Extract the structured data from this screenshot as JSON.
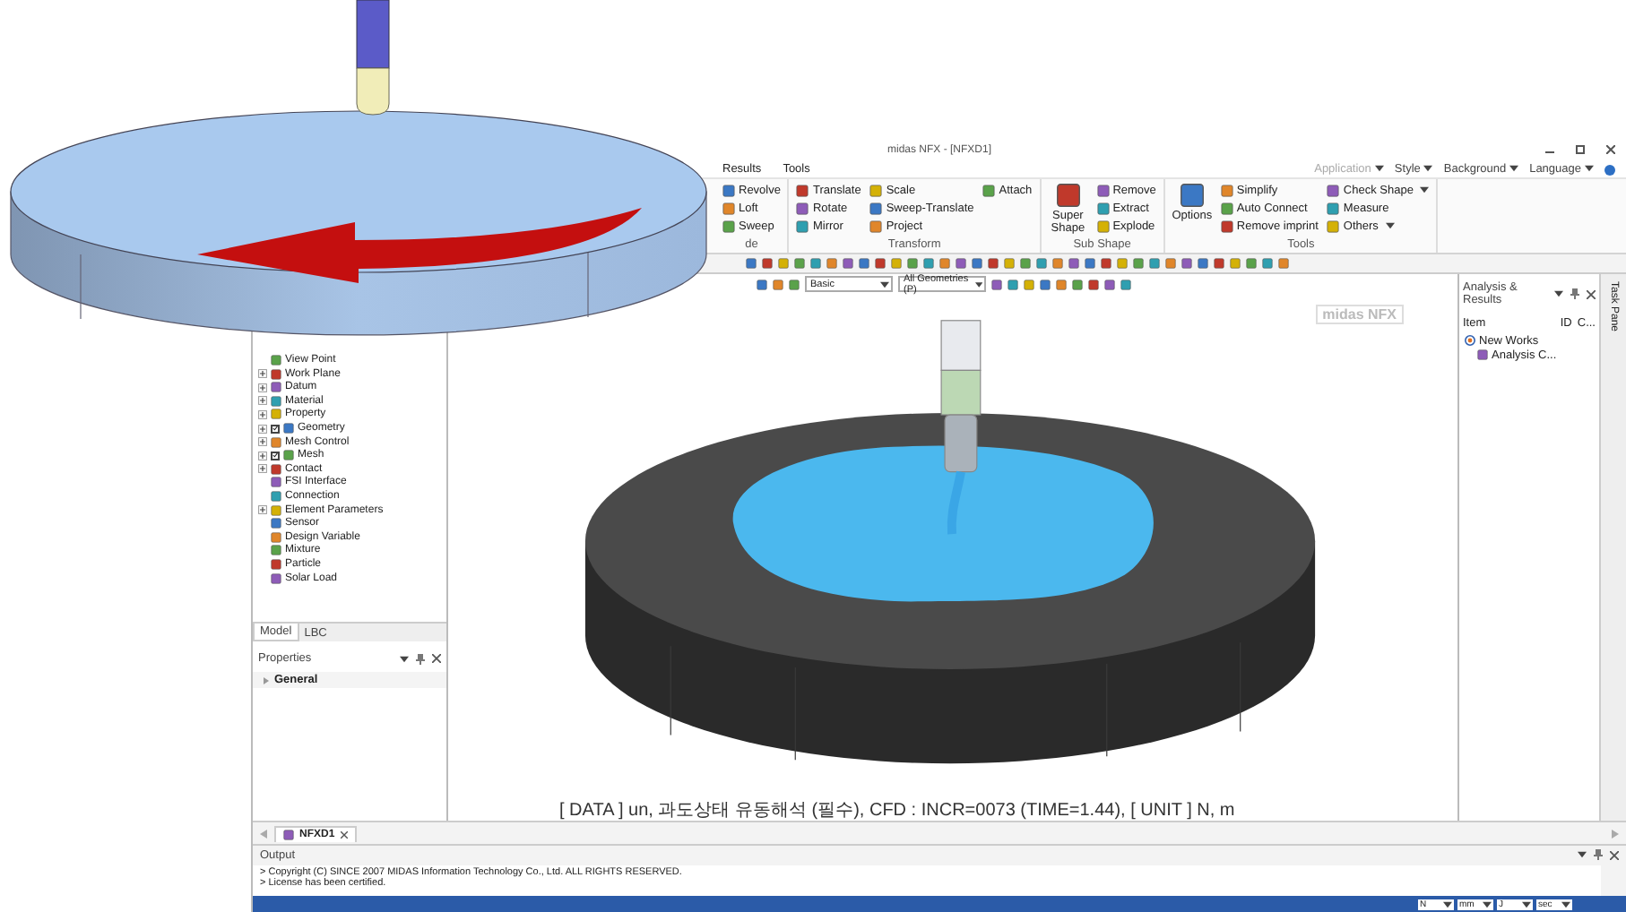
{
  "window": {
    "title": "midas NFX - [NFXD1]"
  },
  "menu": [
    {
      "label": "Results"
    },
    {
      "label": "Tools"
    }
  ],
  "quick_menu": [
    {
      "label": "Application",
      "disabled": true
    },
    {
      "label": "Style",
      "disabled": false
    },
    {
      "label": "Background",
      "disabled": false
    },
    {
      "label": "Language",
      "disabled": false
    }
  ],
  "ribbon": [
    {
      "label": "de",
      "columns": [
        [
          {
            "label": "Revolve",
            "kind": "small"
          },
          {
            "label": "Loft",
            "kind": "small"
          },
          {
            "label": "Sweep",
            "kind": "small"
          }
        ]
      ]
    },
    {
      "label": "Transform",
      "columns": [
        [
          {
            "label": "Translate",
            "kind": "small"
          },
          {
            "label": "Rotate",
            "kind": "small"
          },
          {
            "label": "Mirror",
            "kind": "small"
          }
        ],
        [
          {
            "label": "Scale",
            "kind": "small"
          },
          {
            "label": "Sweep-Translate",
            "kind": "small"
          },
          {
            "label": "Project",
            "kind": "small"
          }
        ],
        [
          {
            "label": "Attach",
            "kind": "small"
          }
        ]
      ]
    },
    {
      "label": "Sub Shape",
      "columns": [
        [
          {
            "label": "Super Shape",
            "kind": "large"
          }
        ],
        [
          {
            "label": "Remove",
            "kind": "small"
          },
          {
            "label": "Extract",
            "kind": "small"
          },
          {
            "label": "Explode",
            "kind": "small"
          }
        ]
      ]
    },
    {
      "label": "Tools",
      "columns": [
        [
          {
            "label": "Options",
            "kind": "large"
          }
        ],
        [
          {
            "label": "Simplify",
            "kind": "small"
          },
          {
            "label": "Auto Connect",
            "kind": "small"
          },
          {
            "label": "Remove imprint",
            "kind": "small"
          }
        ],
        [
          {
            "label": "Check Shape",
            "kind": "menu"
          },
          {
            "label": "Measure",
            "kind": "small"
          },
          {
            "label": "Others",
            "kind": "menu"
          }
        ]
      ]
    }
  ],
  "tree": [
    {
      "label": "View Point",
      "expandable": false,
      "kind": "plain"
    },
    {
      "label": "Work Plane",
      "expandable": true,
      "kind": "plain"
    },
    {
      "label": "Datum",
      "expandable": true,
      "kind": "plain"
    },
    {
      "label": "Material",
      "expandable": true,
      "kind": "plain"
    },
    {
      "label": "Property",
      "expandable": true,
      "kind": "plain"
    },
    {
      "label": "Geometry",
      "expandable": true,
      "kind": "check",
      "checked": true
    },
    {
      "label": "Mesh Control",
      "expandable": true,
      "kind": "plain"
    },
    {
      "label": "Mesh",
      "expandable": true,
      "kind": "check",
      "checked": true
    },
    {
      "label": "Contact",
      "expandable": true,
      "kind": "plain"
    },
    {
      "label": "FSI Interface",
      "expandable": false,
      "kind": "plain"
    },
    {
      "label": "Connection",
      "expandable": false,
      "kind": "plain"
    },
    {
      "label": "Element Parameters",
      "expandable": true,
      "kind": "plain"
    },
    {
      "label": "Sensor",
      "expandable": false,
      "kind": "plain"
    },
    {
      "label": "Design Variable",
      "expandable": false,
      "kind": "plain"
    },
    {
      "label": "Mixture",
      "expandable": false,
      "kind": "plain"
    },
    {
      "label": "Particle",
      "expandable": false,
      "kind": "plain"
    },
    {
      "label": "Solar Load",
      "expandable": false,
      "kind": "plain"
    }
  ],
  "left_tabs": [
    {
      "label": "Model",
      "selected": true
    },
    {
      "label": "LBC",
      "selected": false
    }
  ],
  "properties": {
    "title": "Properties",
    "sections": [
      {
        "label": "General"
      }
    ]
  },
  "view_toolbar": {
    "dropdowns": [
      {
        "value": "Basic"
      },
      {
        "value": "All Geometries (P)"
      }
    ]
  },
  "viewport": {
    "logo": "midas NFX",
    "caption": "[ DATA ] un, 과도상태 유동해석 (필수), CFD : INCR=0073 (TIME=1.44), [ UNIT ] N, m"
  },
  "analysis_panel": {
    "title": "Analysis & Results",
    "columns": [
      "Item",
      "ID",
      "C..."
    ],
    "tree": [
      {
        "label": "New Works",
        "children": [
          {
            "label": "Analysis C..."
          }
        ]
      }
    ]
  },
  "task_pane": {
    "label": "Task Pane"
  },
  "doc_tabs": [
    {
      "label": "NFXD1",
      "selected": true
    }
  ],
  "output": {
    "title": "Output",
    "lines": [
      "> Copyright (C) SINCE 2007 MIDAS Information Technology Co., Ltd. ALL RIGHTS RESERVED.",
      "> License has been certified."
    ]
  },
  "status_bar": {
    "units": [
      "N",
      "mm",
      "J",
      "sec"
    ]
  }
}
